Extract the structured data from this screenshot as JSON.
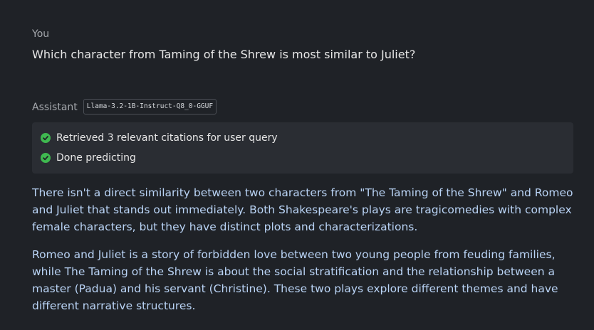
{
  "conversation": {
    "user": {
      "role_label": "You",
      "message": "Which character from Taming of the Shrew is most similar to Juliet?"
    },
    "assistant": {
      "role_label": "Assistant",
      "model": "Llama-3.2-1B-Instruct-Q8_0-GGUF",
      "status": [
        {
          "text": "Retrieved 3 relevant citations for user query",
          "icon": "check-circle-icon"
        },
        {
          "text": "Done predicting",
          "icon": "check-circle-icon"
        }
      ],
      "paragraphs": [
        "There isn't a direct similarity between two characters from \"The Taming of the Shrew\" and Romeo and Juliet that stands out immediately. Both Shakespeare's plays are tragicomedies with complex female characters, but they have distinct plots and characterizations.",
        "Romeo and Juliet is a story of forbidden love between two young people from feuding families, while The Taming of the Shrew is about the social stratification and the relationship between a master (Padua) and his servant (Christine). These two plays explore different themes and have different narrative structures."
      ]
    }
  },
  "colors": {
    "background": "#1f2227",
    "status_box": "#2a2d33",
    "check": "#3fb950",
    "response_text": "#b9d3f5"
  }
}
